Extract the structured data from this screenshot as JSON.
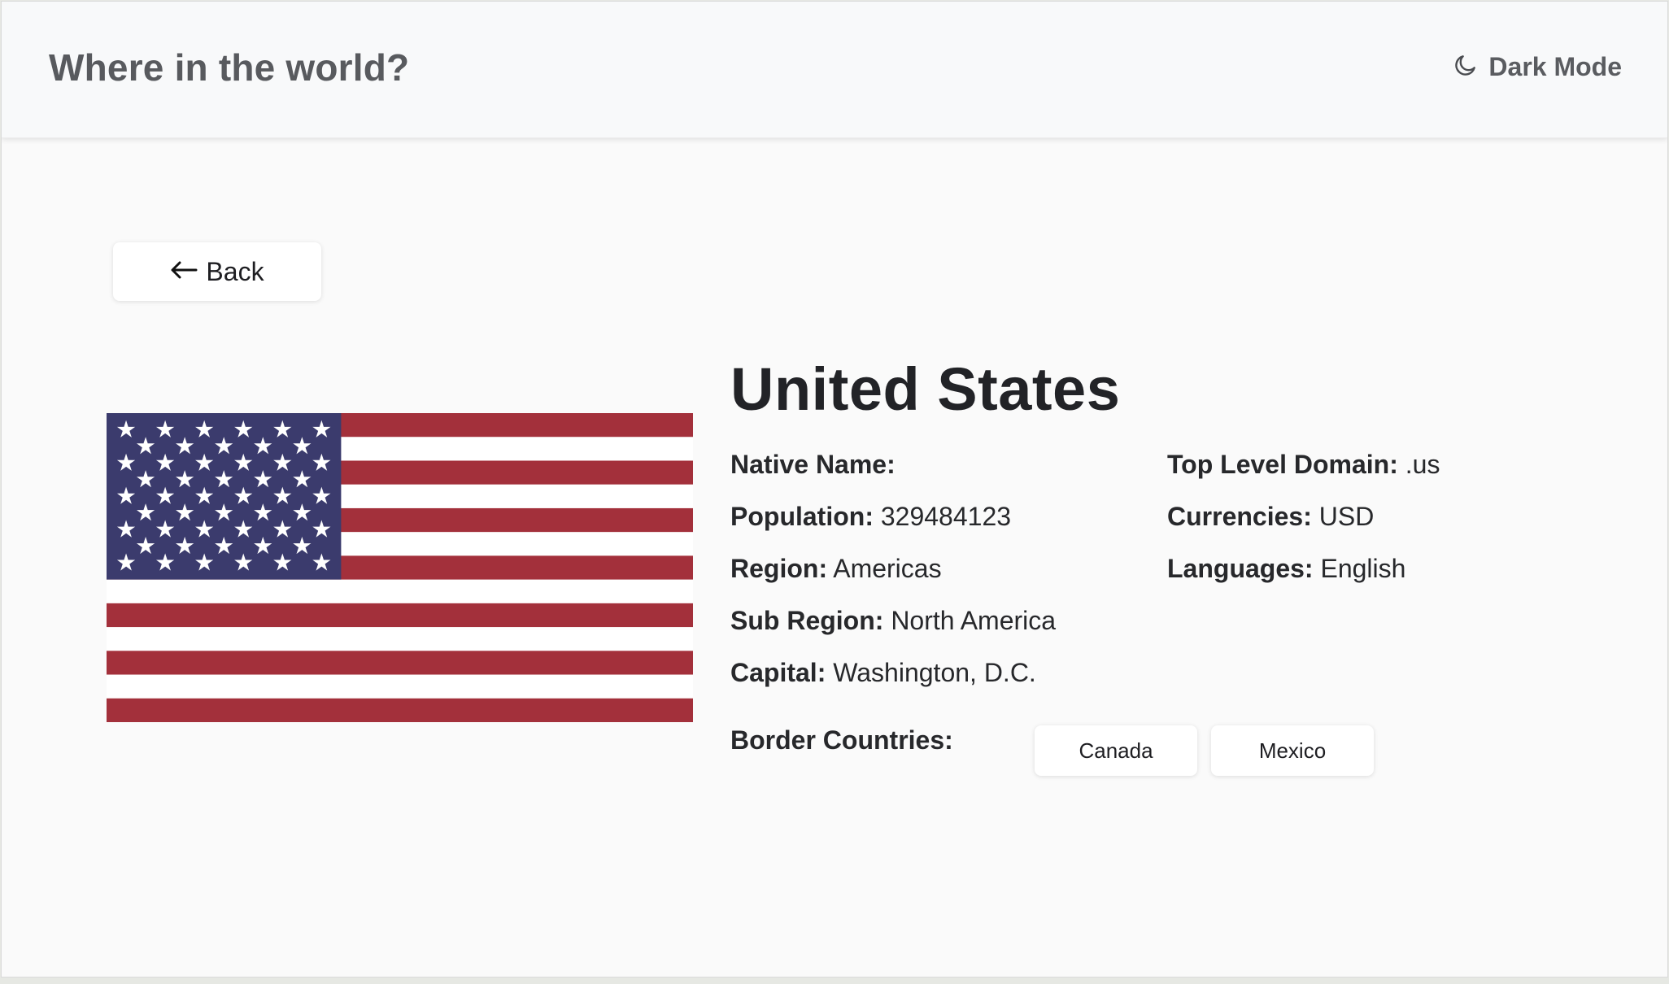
{
  "header": {
    "title": "Where in the world?",
    "mode_toggle": {
      "icon": "moon-icon",
      "label": "Dark Mode"
    }
  },
  "back_button": {
    "icon": "arrow-left-icon",
    "label": "Back"
  },
  "country": {
    "name": "United States",
    "flag": "us-flag",
    "details_left": [
      {
        "label": "Native Name:",
        "value": ""
      },
      {
        "label": "Population:",
        "value": "329484123"
      },
      {
        "label": "Region:",
        "value": "Americas"
      },
      {
        "label": "Sub Region:",
        "value": "North America"
      },
      {
        "label": "Capital:",
        "value": "Washington, D.C."
      }
    ],
    "details_right": [
      {
        "label": "Top Level Domain:",
        "value": ".us"
      },
      {
        "label": "Currencies:",
        "value": "USD"
      },
      {
        "label": "Languages:",
        "value": "English"
      }
    ],
    "border_countries_label": "Border Countries:",
    "border_countries": [
      "Canada",
      "Mexico"
    ]
  },
  "colors": {
    "page_background": "#fafafa",
    "header_background": "#f8f9fa",
    "flag_red": "#a3303b",
    "flag_blue": "#3b3b6d",
    "flag_white": "#ffffff"
  }
}
